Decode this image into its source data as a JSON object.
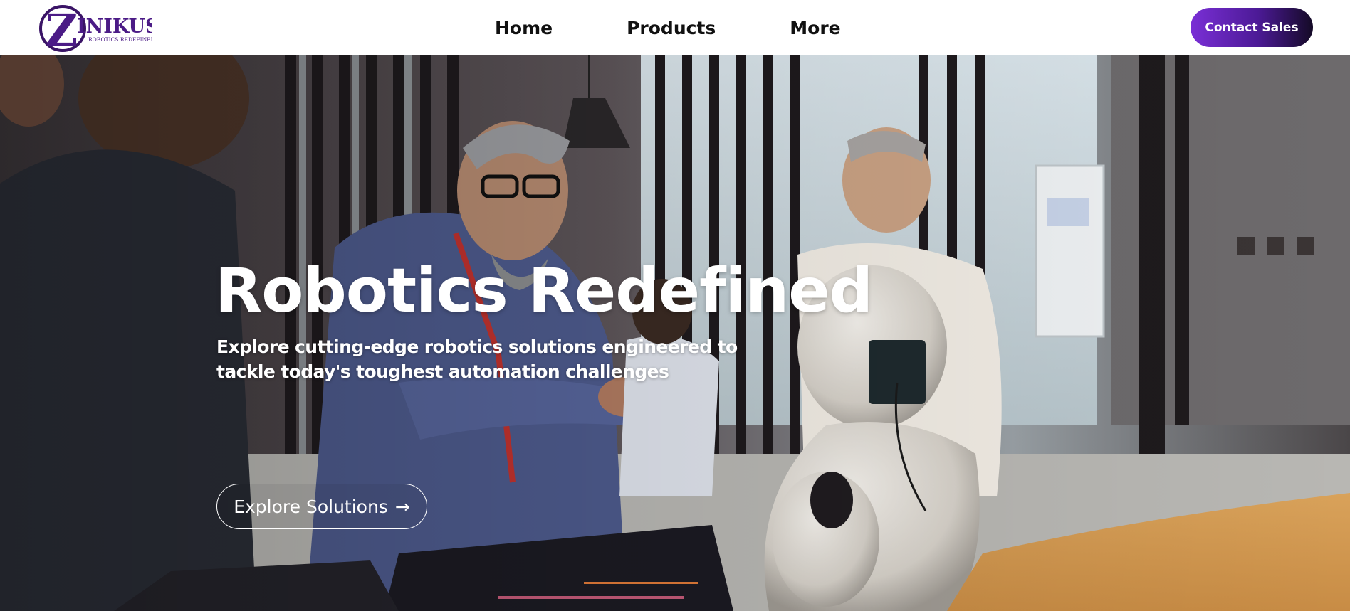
{
  "brand": {
    "name": "ZINIKUS",
    "letter": "Z",
    "tagline": "ROBOTICS REDEFINED",
    "color": "#4b1b86"
  },
  "nav": {
    "items": [
      "Home",
      "Products",
      "More"
    ]
  },
  "header": {
    "contact_label": "Contact Sales"
  },
  "hero": {
    "title": "Robotics Redefined",
    "subtitle": "Explore cutting-edge robotics solutions engineered to tackle today's toughest automation challenges",
    "cta_label": "Explore Solutions",
    "cta_icon": "arrow-right-icon",
    "cta_arrow": "→"
  },
  "colors": {
    "accent_start": "#7a2fd6",
    "accent_end": "#140a26",
    "text_dark": "#111111",
    "text_light": "#ffffff"
  }
}
